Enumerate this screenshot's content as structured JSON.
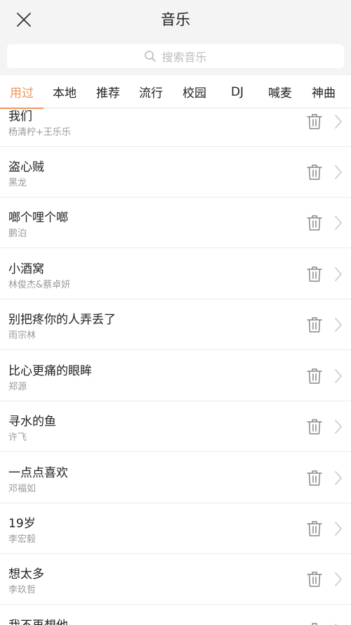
{
  "header": {
    "title": "音乐",
    "close_icon": "close-icon"
  },
  "search": {
    "placeholder": "搜索音乐",
    "icon": "search-icon"
  },
  "tabs": [
    {
      "label": "用过",
      "active": true
    },
    {
      "label": "本地",
      "active": false
    },
    {
      "label": "推荐",
      "active": false
    },
    {
      "label": "流行",
      "active": false
    },
    {
      "label": "校园",
      "active": false
    },
    {
      "label": "DJ",
      "active": false
    },
    {
      "label": "喊麦",
      "active": false
    },
    {
      "label": "神曲",
      "active": false
    }
  ],
  "songs": [
    {
      "title": "我们",
      "artist": "杨清柠+王乐乐"
    },
    {
      "title": "盗心贼",
      "artist": "黑龙"
    },
    {
      "title": "啷个哩个啷",
      "artist": "鹏泊"
    },
    {
      "title": "小酒窝",
      "artist": "林俊杰&蔡卓妍"
    },
    {
      "title": "别把疼你的人弄丢了",
      "artist": "雨宗林"
    },
    {
      "title": "比心更痛的眼眸",
      "artist": "郑源"
    },
    {
      "title": "寻水的鱼",
      "artist": "许飞"
    },
    {
      "title": "一点点喜欢",
      "artist": "邓福如"
    },
    {
      "title": "19岁",
      "artist": "李宏毅"
    },
    {
      "title": "想太多",
      "artist": "李玖哲"
    },
    {
      "title": "我不再想他",
      "artist": ""
    }
  ],
  "row_icons": {
    "delete": "trash-icon",
    "open": "chevron-right-icon"
  },
  "colors": {
    "accent": "#f0965a",
    "background_top": "#f4f4f4",
    "text": "#222222",
    "subtext": "#9a9a9a"
  }
}
